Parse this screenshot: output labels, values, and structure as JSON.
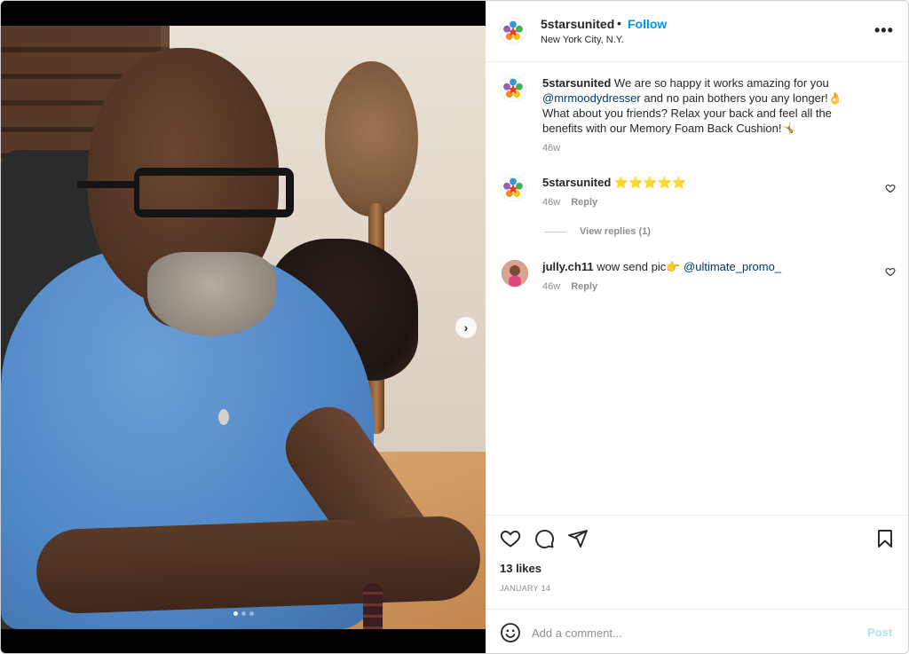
{
  "header": {
    "username": "5starsunited",
    "separator": "•",
    "follow_label": "Follow",
    "location": "New York City, N.Y.",
    "more_label": "•••"
  },
  "caption": {
    "username": "5starsunited",
    "text_1": " We are so happy it works amazing for you ",
    "mention": "@mrmoodydresser",
    "text_2": " and no pain bothers you any longer!👌 What about you friends? Relax your back and feel all the benefits with our Memory Foam Back Cushion!🤸",
    "time": "46w"
  },
  "comments": [
    {
      "username": "5starsunited",
      "text": " ⭐⭐⭐⭐⭐",
      "time": "46w",
      "reply_label": "Reply",
      "view_replies": "View replies (1)"
    },
    {
      "username": "jully.ch11",
      "text": " wow send pic👉 ",
      "mention": "@ultimate_promo_",
      "time": "46w",
      "reply_label": "Reply"
    }
  ],
  "actions": {
    "likes": "13 likes",
    "date": "JANUARY 14"
  },
  "comment_box": {
    "placeholder": "Add a comment...",
    "post_label": "Post"
  },
  "carousel": {
    "next_label": "›",
    "dots": 3,
    "active_dot": 1
  },
  "colors": {
    "follow": "#0095f6",
    "mention": "#00376b",
    "post_disabled": "#b2dffc",
    "text": "#262626",
    "muted": "#8e8e8e"
  },
  "icons": {
    "like": "heart-icon",
    "comment": "comment-icon",
    "share": "paper-plane-icon",
    "save": "bookmark-icon",
    "emoji": "smiley-icon",
    "more": "more-options-icon",
    "next": "chevron-right-icon"
  }
}
